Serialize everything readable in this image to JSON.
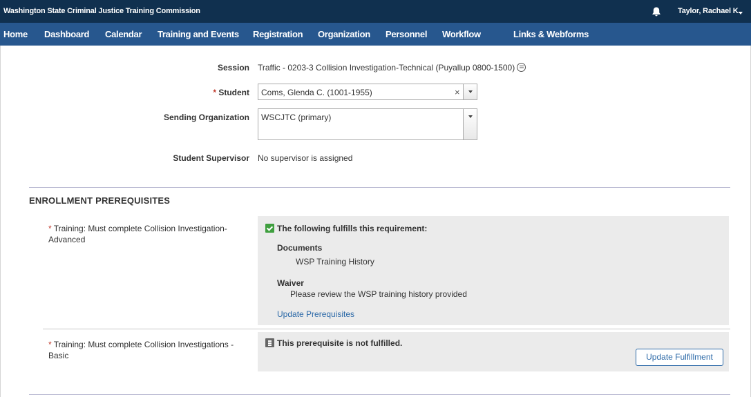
{
  "header": {
    "brand": "Washington State Criminal Justice Training Commission",
    "user_name": "Taylor, Rachael K."
  },
  "nav": {
    "items": [
      {
        "label": "Home"
      },
      {
        "label": "Dashboard"
      },
      {
        "label": "Calendar"
      },
      {
        "label": "Training and Events"
      },
      {
        "label": "Registration"
      },
      {
        "label": "Organization"
      },
      {
        "label": "Personnel"
      },
      {
        "label": "Workflow"
      },
      {
        "label": "Links & Webforms"
      }
    ]
  },
  "form": {
    "session_label": "Session",
    "session_value": "Traffic - 0203-3 Collision Investigation-Technical (Puyallup 0800-1500)",
    "student_required": "*",
    "student_label": "Student",
    "student_value": "Coms, Glenda C. (1001-1955)",
    "student_clear": "×",
    "sending_org_label": "Sending Organization",
    "sending_org_value": "WSCJTC (primary)",
    "supervisor_label": "Student Supervisor",
    "supervisor_value": "No supervisor is assigned"
  },
  "prerequisites": {
    "section_title": "ENROLLMENT PREREQUISITES",
    "items": [
      {
        "required_mark": "*",
        "label": "Training: Must complete Collision Investigation-Advanced",
        "status": "The following fulfills this requirement:",
        "documents_heading": "Documents",
        "documents_value": "WSP Training History",
        "waiver_heading": "Waiver",
        "waiver_value": "Please review the WSP training history provided",
        "action_link": "Update Prerequisites"
      },
      {
        "required_mark": "*",
        "label": "Training: Must complete Collision Investigations - Basic",
        "status": "This prerequisite is not fulfilled.",
        "action_button": "Update Fulfillment"
      }
    ]
  },
  "colors": {
    "topbar": "#10304f",
    "navbar": "#27578e",
    "link": "#2d6aa8",
    "required": "#c0392b",
    "fulfilled_icon": "#3f9f3f",
    "panel": "#ebebeb"
  },
  "icons": {
    "notifications": "bell-icon",
    "user_menu": "caret-down-icon",
    "session_notes": "note-icon",
    "fulfilled": "check-icon",
    "not_fulfilled": "list-icon"
  }
}
